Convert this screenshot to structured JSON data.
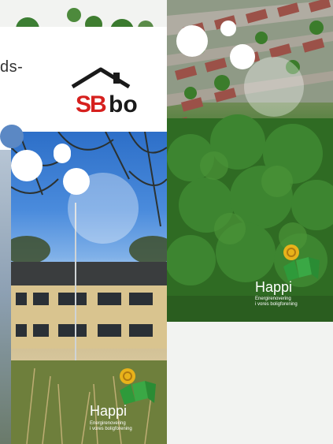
{
  "sbbo_panel": {
    "fragment_text": "ds-",
    "logo_text": "SBbo",
    "logo_s": "S",
    "logo_b": "B",
    "logo_bo": "bo"
  },
  "brochures": [
    {
      "id": "aerial",
      "brand": "Happi",
      "tagline_line1": "Energirenovering",
      "tagline_line2": "i vores boligforening"
    },
    {
      "id": "school",
      "brand": "Happi",
      "tagline_line1": "Energirenovering",
      "tagline_line2": "i vores boligforening"
    }
  ],
  "colors": {
    "logo_red": "#d6201e",
    "logo_black": "#1a1a1a",
    "happi_yellow": "#e8b21a",
    "happi_green": "#2e9a3a"
  }
}
